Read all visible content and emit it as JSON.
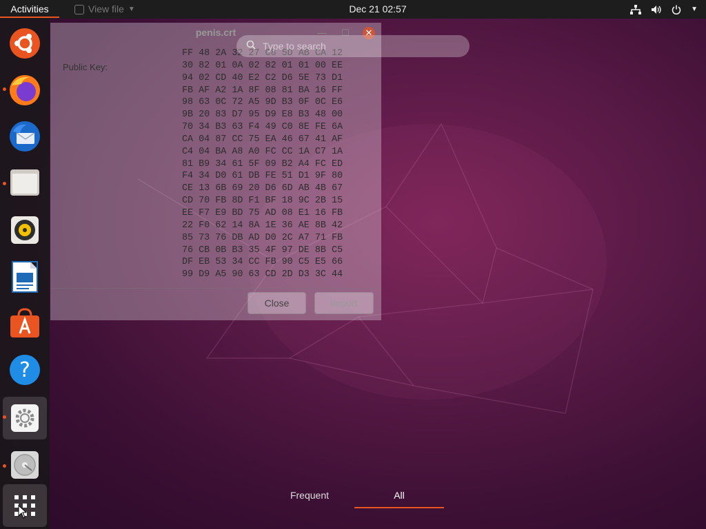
{
  "topbar": {
    "activities": "Activities",
    "app_menu": "View file",
    "clock": "Dec 21  02:57"
  },
  "dock": {
    "items": [
      {
        "icon": "ubuntu-icon",
        "running": false,
        "active": false
      },
      {
        "icon": "firefox-icon",
        "running": true,
        "active": false
      },
      {
        "icon": "thunderbird-icon",
        "running": false,
        "active": false
      },
      {
        "icon": "files-icon",
        "running": true,
        "active": false
      },
      {
        "icon": "rhythmbox-icon",
        "running": false,
        "active": false
      },
      {
        "icon": "libreoffice-writer-icon",
        "running": false,
        "active": false
      },
      {
        "icon": "ubuntu-software-icon",
        "running": false,
        "active": false
      },
      {
        "icon": "help-icon",
        "running": false,
        "active": false
      },
      {
        "icon": "settings-icon",
        "running": true,
        "active": true
      },
      {
        "icon": "disk-icon",
        "running": true,
        "active": false
      },
      {
        "icon": "show-applications-icon",
        "running": false,
        "active": true
      }
    ]
  },
  "search": {
    "placeholder": "Type to search"
  },
  "dialog": {
    "title": "penis.crt",
    "public_key_label": "Public Key:",
    "hex_lines": [
      "FF 48 2A 32 27 C8 5D AB CA 12",
      "30 82 01 0A 02 82 01 01 00 EE",
      "94 02 CD 40 E2 C2 D6 5E 73 D1",
      "FB AF A2 1A 8F 08 81 BA 16 FF",
      "98 63 0C 72 A5 9D B3 0F 0C E6",
      "9B 20 83 D7 95 D9 E8 B3 48 00",
      "70 34 B3 63 F4 49 C0 8E FE 6A",
      "CA 04 87 CC 75 EA 46 67 41 AF",
      "C4 04 BA A8 A0 FC CC 1A C7 1A",
      "81 B9 34 61 5F 09 B2 A4 FC ED",
      "F4 34 D0 61 DB FE 51 D1 9F 80",
      "CE 13 6B 69 20 D6 6D AB 4B 67",
      "CD 70 FB 8D F1 BF 18 9C 2B 15",
      "EE F7 E9 BD 75 AD 08 E1 16 FB",
      "22 F0 62 14 8A 1E 36 AE 8B 42",
      "85 73 76 DB AD D0 2C A7 71 FB",
      "76 CB 0B B3 35 4F 97 DE 8B C5",
      "DF EB 53 34 CC FB 90 C5 E5 66",
      "99 D9 A5 90 63 CD 2D D3 3C 44"
    ],
    "close_label": "Close",
    "import_label": "Import"
  },
  "overview_tabs": [
    {
      "label": "Frequent",
      "selected": false
    },
    {
      "label": "All",
      "selected": true
    }
  ],
  "colors": {
    "accent": "#e95420",
    "topbar": "#1d1d1d"
  }
}
